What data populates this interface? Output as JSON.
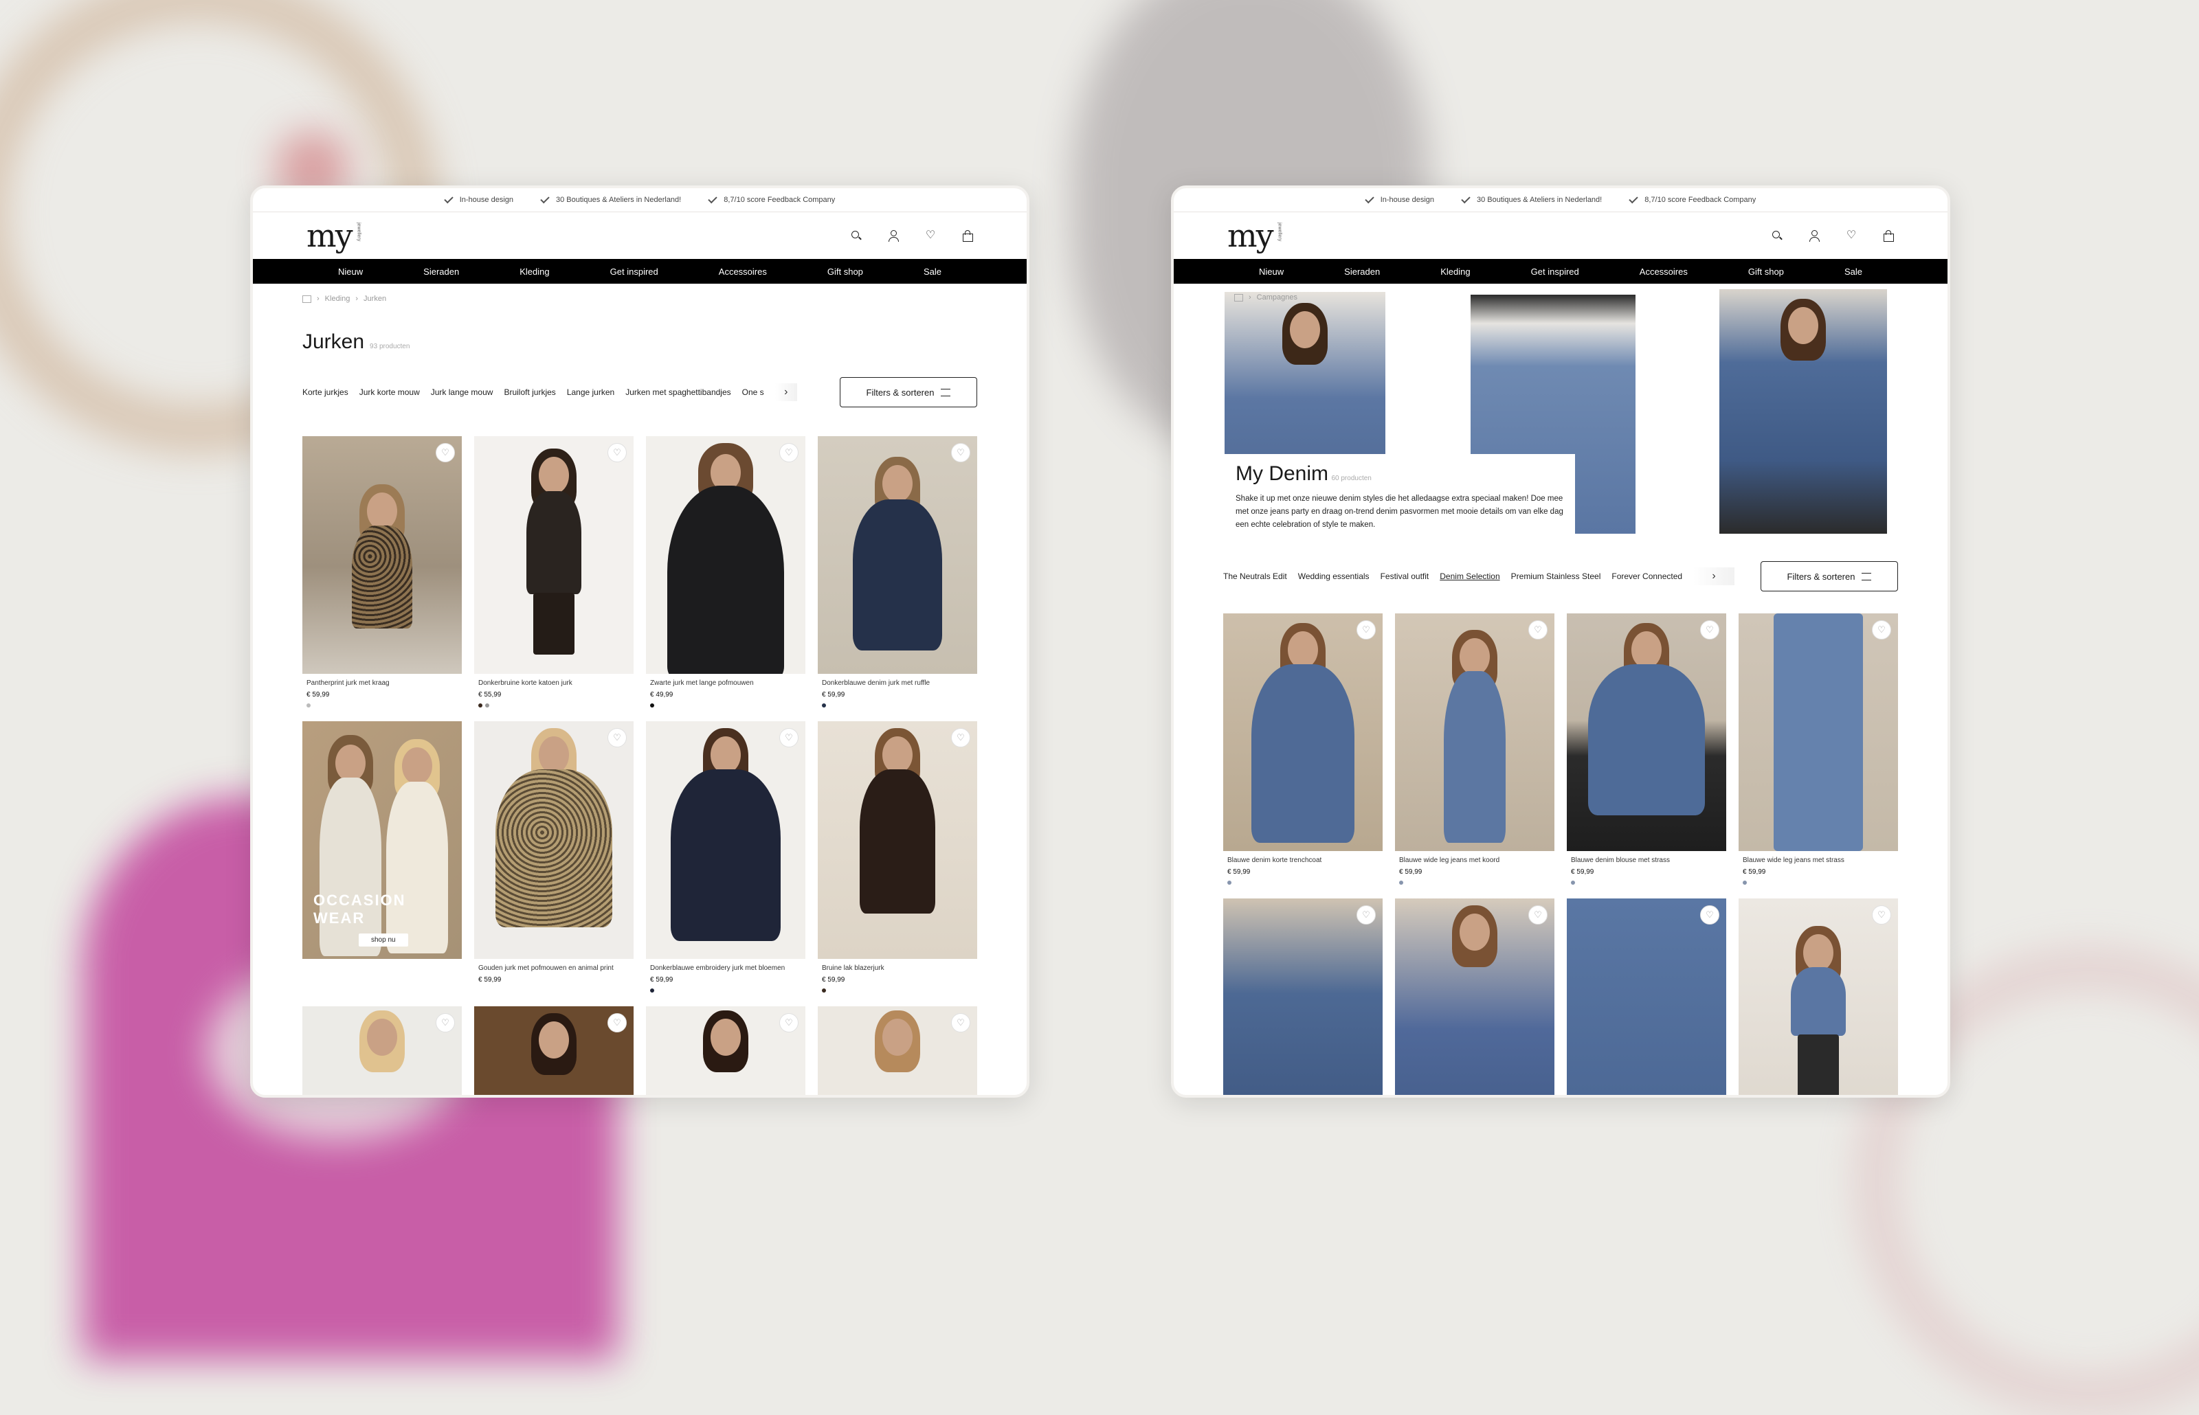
{
  "usp": [
    "In-house design",
    "30 Boutiques & Ateliers in Nederland!",
    "8,7/10 score Feedback Company"
  ],
  "logo": {
    "text": "my",
    "sub": "jewellery"
  },
  "nav": [
    "Nieuw",
    "Sieraden",
    "Kleding",
    "Get inspired",
    "Accessoires",
    "Gift shop",
    "Sale"
  ],
  "left": {
    "breadcrumb": [
      "Kleding",
      "Jurken"
    ],
    "title": "Jurken",
    "count": "93 producten",
    "chips": [
      "Korte jurkjes",
      "Jurk korte mouw",
      "Jurk lange mouw",
      "Bruiloft jurkjes",
      "Lange jurken",
      "Jurken met spaghettibandjes",
      "One s"
    ],
    "filter_label": "Filters & sorteren",
    "products": [
      {
        "name": "Pantherprint jurk met kraag",
        "price": "€ 59,99"
      },
      {
        "name": "Donkerbruine korte katoen jurk",
        "price": "€ 55,99"
      },
      {
        "name": "Zwarte jurk met lange pofmouwen",
        "price": "€ 49,99"
      },
      {
        "name": "Donkerblauwe denim jurk met ruffle",
        "price": "€ 59,99"
      },
      {
        "name": "",
        "price": "",
        "banner_title": "OCCASION WEAR",
        "banner_cta": "shop nu"
      },
      {
        "name": "Gouden jurk met pofmouwen en animal print",
        "price": "€ 59,99"
      },
      {
        "name": "Donkerblauwe embroidery jurk met bloemen",
        "price": "€ 59,99"
      },
      {
        "name": "Bruine lak blazerjurk",
        "price": "€ 59,99"
      }
    ]
  },
  "right": {
    "breadcrumb": [
      "Campagnes"
    ],
    "title": "My Denim",
    "count": "60 producten",
    "description": "Shake it up met onze nieuwe denim styles die het alledaagse extra speciaal maken! Doe mee met onze jeans party en draag on-trend denim pasvormen met mooie details om van elke dag een echte celebration of style te maken.",
    "chips": [
      "The Neutrals Edit",
      "Wedding essentials",
      "Festival outfit",
      "Denim Selection",
      "Premium Stainless Steel",
      "Forever Connected"
    ],
    "active_chip": "Denim Selection",
    "filter_label": "Filters & sorteren",
    "products": [
      {
        "name": "Blauwe denim korte trenchcoat",
        "price": "€ 59,99"
      },
      {
        "name": "Blauwe wide leg jeans met koord",
        "price": "€ 59,99"
      },
      {
        "name": "Blauwe denim blouse met strass",
        "price": "€ 59,99"
      },
      {
        "name": "Blauwe wide leg jeans met strass",
        "price": "€ 59,99"
      }
    ]
  },
  "colors": {
    "nav": "#000000",
    "denim": "#4e6a96",
    "background": "#ecebe7"
  }
}
